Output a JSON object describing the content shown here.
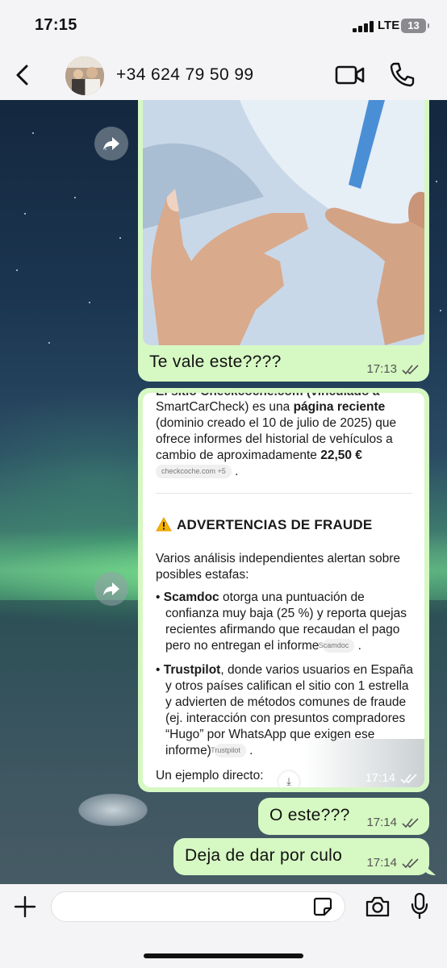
{
  "status_bar": {
    "time": "17:15",
    "network": "LTE",
    "battery": "13"
  },
  "header": {
    "contact_name": "+34 624 79 50 99"
  },
  "messages": [
    {
      "type": "image",
      "caption": "Te vale este????",
      "time": "17:13"
    },
    {
      "type": "document",
      "time": "17:14",
      "top_cut_text": "El sitio Checkcoche.com (vinculado a",
      "intro_text": "SmartCarCheck) es una ",
      "intro_bold": "página reciente",
      "intro_rest": " (dominio creado el 10 de julio de 2025) que ofrece informes del historial de vehículos a cambio de aproximadamente ",
      "price": "22,50 €",
      "source_chip": "checkcoche.com +5",
      "heading": "ADVERTENCIAS DE FRAUDE",
      "paragraph": "Varios análisis independientes alertan sobre posibles estafas:",
      "bullet1_bold": "Scamdoc",
      "bullet1_text": " otorga una puntuación de confianza muy baja (25 %) y reporta quejas recientes afirmando que recaudan el pago pero no entregan el informe ",
      "bullet1_chip": "Scamdoc",
      "bullet2_bold": "Trustpilot",
      "bullet2_text": ", donde varios usuarios en España y otros países califican el sitio con 1 estrella y advierten de métodos comunes de fraude (ej. interacción con presuntos compradores “Hugo” por WhatsApp que exigen ese informe) ",
      "bullet2_chip": "Trustpilot",
      "example": "Un ejemplo directo:"
    },
    {
      "type": "text",
      "text": "O este???",
      "time": "17:14"
    },
    {
      "type": "text",
      "text": "Deja de dar por culo",
      "time": "17:14"
    }
  ],
  "input": {
    "placeholder": ""
  },
  "colors": {
    "outgoing_bubble": "#d6f8c3",
    "bar_background": "#f4f4f6",
    "read_ticks": "#555555"
  },
  "icons": [
    "back-chevron-icon",
    "video-call-icon",
    "phone-icon",
    "forward-icon",
    "warning-icon",
    "download-icon",
    "plus-icon",
    "sticker-icon",
    "camera-icon",
    "microphone-icon"
  ]
}
